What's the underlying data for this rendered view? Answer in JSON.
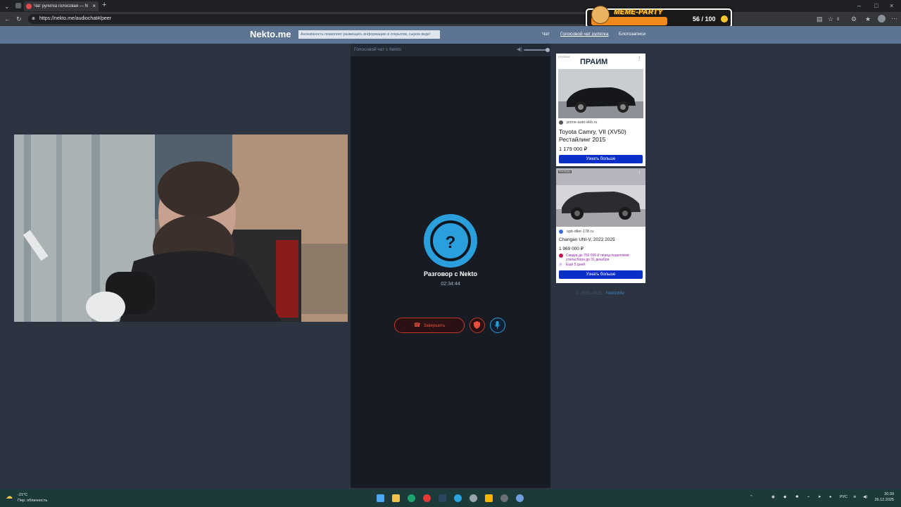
{
  "browser": {
    "tab_title": "Чат рулетка голосовая — N",
    "url": "https://nekto.me/audiochat#/peer",
    "downloads_count": "8"
  },
  "overlay": {
    "logo_text": "MEME-PARTY",
    "score": "56 / 100"
  },
  "site": {
    "brand": "Nekto.me",
    "notice": "Анонимность позволяет размещать информацию в открытом, сыром виде!",
    "nav": [
      "Чат",
      "Голосовой чат рулетка",
      "Блогозаписи"
    ]
  },
  "chat": {
    "header": "Голосовой чат с Nekto",
    "avatar_glyph": "?",
    "conversation_title": "Разговор с Nekto",
    "timer": "02:34:44",
    "end_label": "Завершить"
  },
  "ads": [
    {
      "tag": "РЕКЛАМА",
      "brand": "ПРАИМ",
      "domain": "prime-auto-ekb.ru",
      "title": "Toyota Camry, VII (XV50) Рестайлинг 2015",
      "price": "1 179 000 ₽",
      "button": "Узнать больше"
    },
    {
      "tag": "РЕКЛАМА",
      "domain": "spb-diler-178.ru",
      "title": "Changan UNI-V, 2022 2025",
      "price": "1 969 000 ₽",
      "promo": "Скидка до 750 000 ₽ перед поднятием утильсбора до 31 декабря",
      "promo_note": "Ещё 5 дней",
      "button": "Узнать больше"
    }
  ],
  "footer": {
    "copyright": "© 2011-2025",
    "link": "NektoMe"
  },
  "taskbar": {
    "weather_temp": "-21°C",
    "weather_desc": "Пер. облачность",
    "lang": "РУС",
    "time": "20:39",
    "date": "26.12.2025"
  },
  "colors": {
    "accent_blue": "#2b9fdb",
    "end_red": "#e74c3c",
    "header_bg": "#5d7593",
    "page_bg": "#2b3440",
    "ad_button": "#0a2fc9"
  }
}
